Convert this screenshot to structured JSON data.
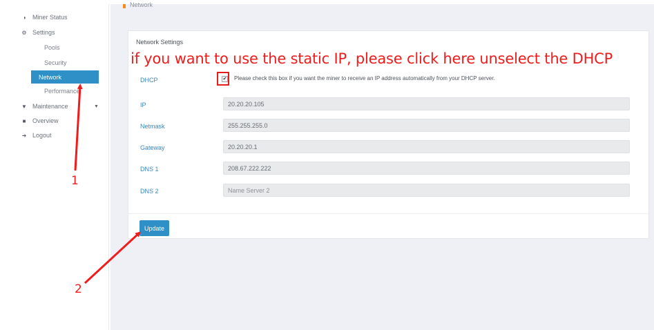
{
  "sidebar": {
    "items": [
      {
        "label": "Miner Status",
        "icon": "dashboard-icon"
      },
      {
        "label": "Settings",
        "icon": "cogs-icon"
      },
      {
        "label": "Maintenance",
        "icon": "plug-icon"
      },
      {
        "label": "Overview",
        "icon": "book-icon"
      },
      {
        "label": "Logout",
        "icon": "sign-out-icon"
      }
    ],
    "settings_sub": [
      "Pools",
      "Security",
      "Network",
      "Performance"
    ],
    "active": "Network"
  },
  "breadcrumb": "Network",
  "card": {
    "title": "Network Settings",
    "dhcp": {
      "label": "DHCP",
      "checked": true,
      "help": "Please check this box if you want the miner to receive an IP address automatically from your DHCP server."
    },
    "fields": [
      {
        "label": "IP",
        "value": "20.20.20.105",
        "placeholder": ""
      },
      {
        "label": "Netmask",
        "value": "255.255.255.0",
        "placeholder": ""
      },
      {
        "label": "Gateway",
        "value": "20.20.20.1",
        "placeholder": ""
      },
      {
        "label": "DNS 1",
        "value": "208.67.222.222",
        "placeholder": ""
      },
      {
        "label": "DNS 2",
        "value": "",
        "placeholder": "Name Server 2"
      }
    ],
    "update_label": "Update"
  },
  "annotations": {
    "instruction": "if you want to use the static IP, please click here unselect the DHCP",
    "step1": "1",
    "step2": "2",
    "color": "#ee1c1c"
  },
  "colors": {
    "accent": "#2f90c8",
    "orange": "#f28c1e",
    "label_blue": "#3a86bd"
  }
}
